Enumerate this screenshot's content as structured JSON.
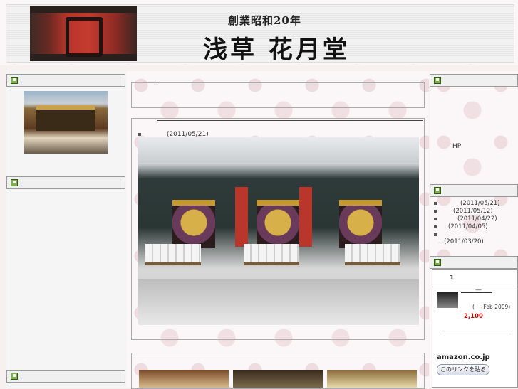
{
  "header": {
    "subtitle": "創業昭和20年",
    "title": "浅草 花月堂"
  },
  "left": {
    "box1_icon": "edit-icon",
    "box2_icon": "edit-icon",
    "box3_icon": "edit-icon"
  },
  "main": {
    "entry_date": "(2011/05/21)"
  },
  "right": {
    "hp_text": "HP",
    "archive": [
      {
        "text": "(2011/05/21)"
      },
      {
        "text": "(2011/05/12)"
      },
      {
        "text": "(2011/04/22)"
      },
      {
        "text": "(2011/04/05)"
      },
      {
        "text": ""
      },
      {
        "text": "...(2011/03/20)"
      }
    ],
    "amazon": {
      "rank": "1",
      "dash": "—",
      "date_text": "(　- Feb 2009)",
      "price": "2,100",
      "brand": "amazon.co.jp",
      "share_button": "このリンクを貼る"
    }
  },
  "colors": {
    "price": "#cc0000",
    "icon_green": "#7fae4a"
  }
}
